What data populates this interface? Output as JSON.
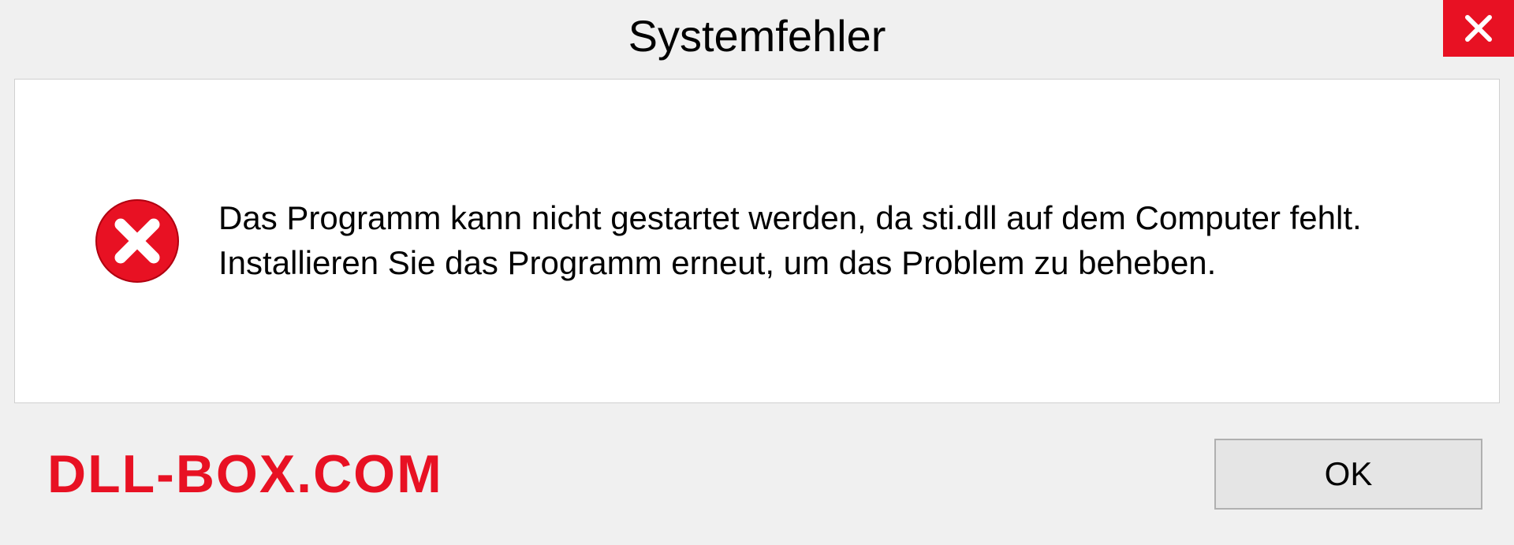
{
  "dialog": {
    "title": "Systemfehler",
    "message": "Das Programm kann nicht gestartet werden, da sti.dll auf dem Computer fehlt. Installieren Sie das Programm erneut, um das Problem zu beheben.",
    "ok_label": "OK"
  },
  "watermark": "DLL-BOX.COM",
  "colors": {
    "accent_red": "#e81123"
  }
}
